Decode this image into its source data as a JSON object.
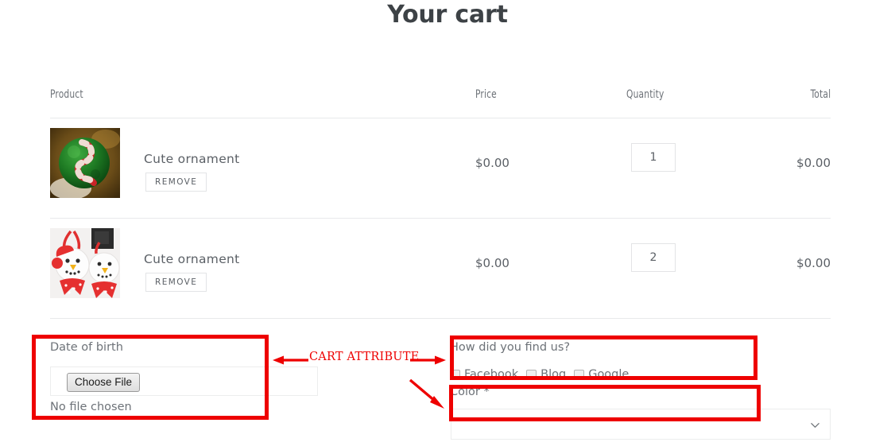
{
  "page": {
    "title": "Your cart"
  },
  "cart": {
    "columns": {
      "product": "Product",
      "price": "Price",
      "quantity": "Quantity",
      "total": "Total"
    },
    "items": [
      {
        "name": "Cute ornament",
        "remove_label": "REMOVE",
        "price": "$0.00",
        "quantity": "1",
        "total": "$0.00",
        "thumb": "green-candycane-ornament-image"
      },
      {
        "name": "Cute ornament",
        "remove_label": "REMOVE",
        "price": "$0.00",
        "quantity": "2",
        "total": "$0.00",
        "thumb": "snowman-ornaments-image"
      }
    ]
  },
  "attributes": {
    "date_of_birth": {
      "label": "Date of birth",
      "choose_file_label": "Choose File",
      "no_file_text": "No file chosen"
    },
    "how_did_you_find_us": {
      "label": "How did you find us?",
      "options": [
        {
          "label": "Facebook",
          "checked": false
        },
        {
          "label": "Blog",
          "checked": false
        },
        {
          "label": "Google",
          "checked": false
        }
      ]
    },
    "color": {
      "label": "Color *",
      "selected_value": "",
      "chevron_icon": "chevron-down-icon"
    }
  },
  "annotations": {
    "caption": "CART ATTRIBUTE",
    "color": "#ee0000"
  }
}
